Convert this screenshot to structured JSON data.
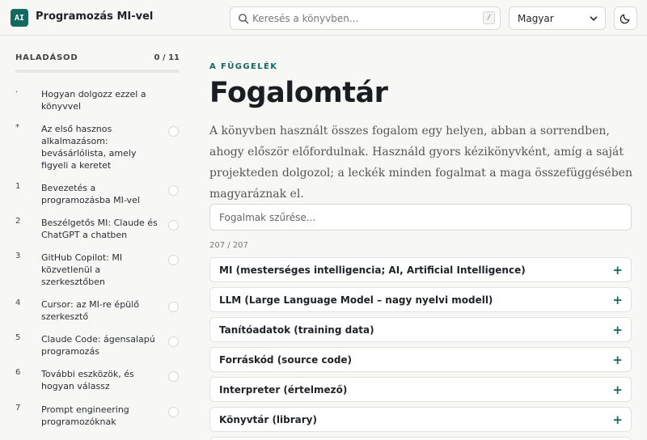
{
  "header": {
    "logo_text": "AI",
    "title": "Programozás MI-vel",
    "search_placeholder": "Keresés a könyvben...",
    "search_shortcut": "/",
    "language": "Magyar",
    "theme_icon": "moon-icon"
  },
  "sidebar": {
    "progress_label": "HALADÁSOD",
    "progress_count": "0 / 11",
    "progress_value": 0,
    "items": [
      {
        "num": "·",
        "label": "Hogyan dolgozz ezzel a könyvvel"
      },
      {
        "num": "*",
        "label": "Az első hasznos alkalmazásom: bevásárlólista, amely figyeli a keretet"
      },
      {
        "num": "1",
        "label": "Bevezetés a programozásba MI-vel"
      },
      {
        "num": "2",
        "label": "Beszélgetős MI: Claude és ChatGPT a chatben"
      },
      {
        "num": "3",
        "label": "GitHub Copilot: MI közvetlenül a szerkesztőben"
      },
      {
        "num": "4",
        "label": "Cursor: az MI-re épülő szerkesztő"
      },
      {
        "num": "5",
        "label": "Claude Code: ágensalapú programozás"
      },
      {
        "num": "6",
        "label": "További eszközök, és hogyan válassz"
      },
      {
        "num": "7",
        "label": "Prompt engineering programozóknak"
      }
    ]
  },
  "main": {
    "kicker": "A FÜGGELÉK",
    "title": "Fogalomtár",
    "intro": "A könyvben használt összes fogalom egy helyen, abban a sorrendben, ahogy először előfordulnak. Használd gyors kézikönyvként, amíg a saját projekteden dolgozol; a leckék minden fogalmat a maga összefüggésében magyaráznak el.",
    "filter_placeholder": "Fogalmak szűrése...",
    "count": "207 / 207",
    "expand_symbol": "+",
    "terms": [
      "MI (mesterséges intelligencia; AI, Artificial Intelligence)",
      "LLM (Large Language Model – nagy nyelvi modell)",
      "Tanítóadatok (training data)",
      "Forráskód (source code)",
      "Interpreter (értelmező)",
      "Könyvtár (library)"
    ]
  },
  "colors": {
    "accent": "#12695e",
    "background": "#f7f7f5"
  }
}
